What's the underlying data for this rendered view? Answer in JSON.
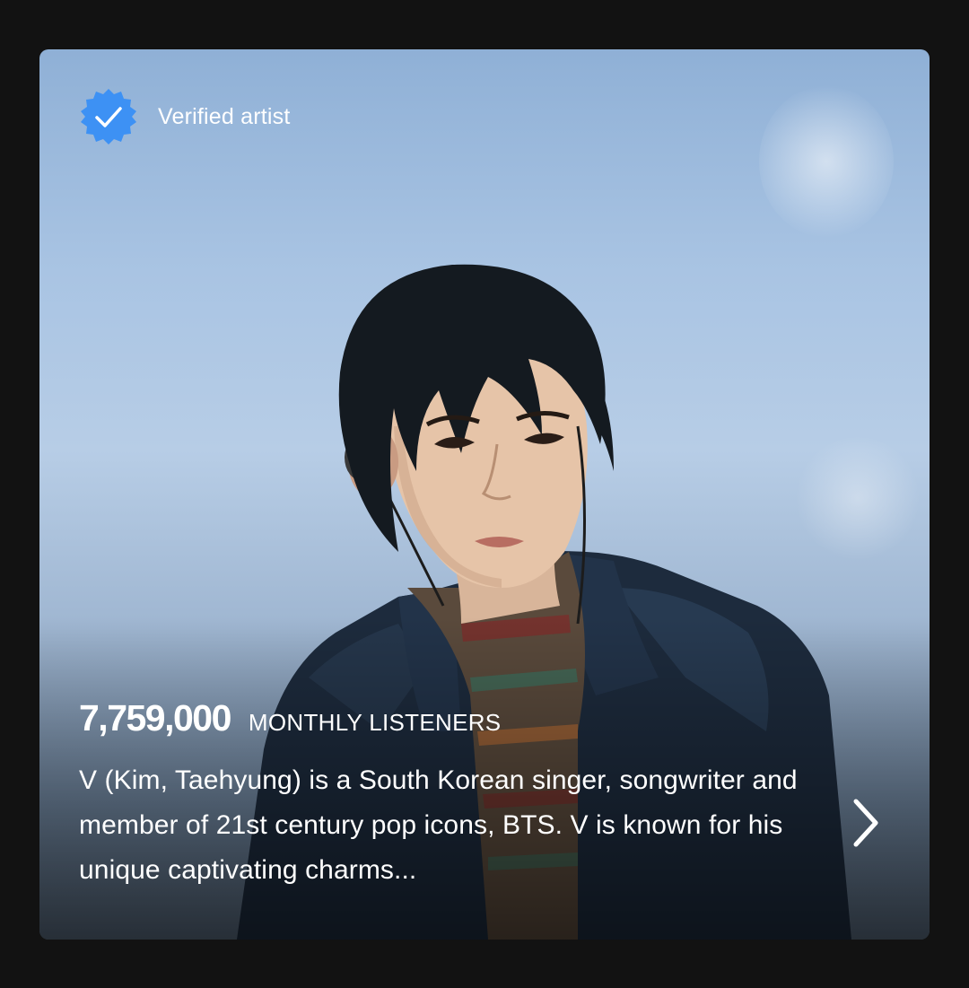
{
  "artist_card": {
    "verified_label": "Verified artist",
    "monthly_listeners_count": "7,759,000",
    "monthly_listeners_label": "MONTHLY LISTENERS",
    "bio": "V (Kim, Taehyung) is a South Korean singer, songwriter and member of 21st century pop icons, BTS. V is known for his unique captivating charms...",
    "icons": {
      "verified": "verified-badge-icon",
      "more": "chevron-right-icon"
    },
    "colors": {
      "verified_badge": "#3d91f4",
      "background": "#121212",
      "text": "#ffffff"
    }
  }
}
